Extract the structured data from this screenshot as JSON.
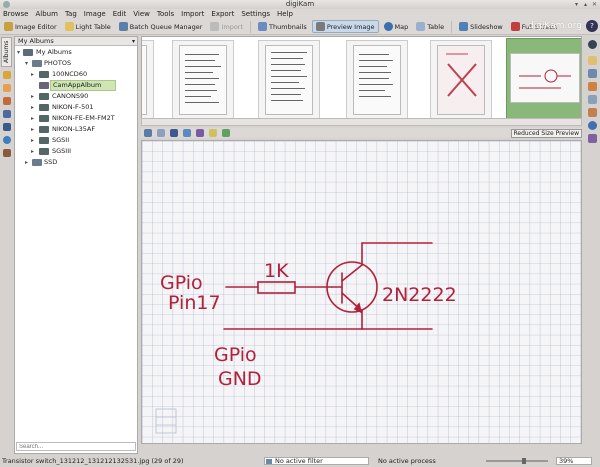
{
  "window": {
    "title": "digiKam"
  },
  "menu": [
    "Browse",
    "Album",
    "Tag",
    "Image",
    "Edit",
    "View",
    "Tools",
    "Import",
    "Export",
    "Settings",
    "Help"
  ],
  "toolbar": {
    "image_editor": "Image Editor",
    "light_table": "Light Table",
    "batch_queue": "Batch Queue Manager",
    "import": "Import",
    "thumbnails": "Thumbnails",
    "preview_image": "Preview Image",
    "map": "Map",
    "table": "Table",
    "slideshow": "Slideshow",
    "full_screen": "Full Screen",
    "brand": "digiKam.org"
  },
  "sidebar": {
    "tab_label": "Albums",
    "header": "My Albums",
    "root": "My Albums",
    "items": [
      {
        "label": "PHOTOS",
        "expander": "▾"
      },
      {
        "label": "100NCD60",
        "expander": "▸"
      },
      {
        "label": "CamAppAlbum",
        "expander": ""
      },
      {
        "label": "CANONS90",
        "expander": "▸"
      },
      {
        "label": "NIKON-F-501",
        "expander": "▸"
      },
      {
        "label": "NIKON-FE-EM-FM2T",
        "expander": "▸"
      },
      {
        "label": "NIKON-L35AF",
        "expander": "▸"
      },
      {
        "label": "SGSII",
        "expander": "▸"
      },
      {
        "label": "SGSIII",
        "expander": "▸"
      },
      {
        "label": "SSD",
        "expander": "▸"
      }
    ],
    "search_placeholder": "Search..."
  },
  "preview": {
    "badge": "Reduced Size Preview",
    "sketch": {
      "gpio_pin_line1": "GPio",
      "gpio_pin_line2": "Pin17",
      "resistor": "1K",
      "transistor": "2N2222",
      "gpio_gnd_line1": "GPio",
      "gpio_gnd_line2": "GND"
    }
  },
  "status": {
    "file": "Transistor switch_131212_131212132531.jpg (29 of 29)",
    "filter": "No active filter",
    "process": "No active process",
    "zoom": "39%"
  },
  "colors": {
    "selection": "#cfe5b4",
    "ink": "#b2203a",
    "grid": "#9aa8bf",
    "paper": "#f5f4f7"
  }
}
